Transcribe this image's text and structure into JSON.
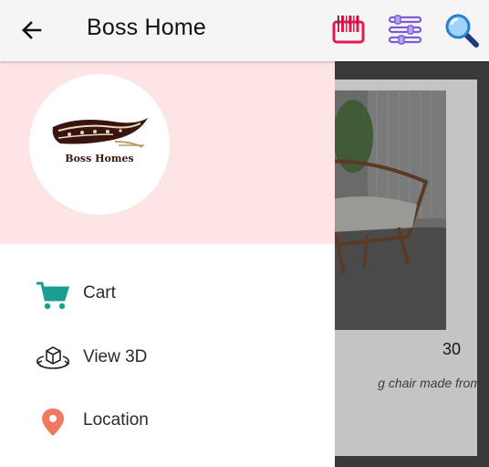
{
  "app_bar": {
    "title": "Boss Home",
    "icons": [
      "back-arrow-icon",
      "barcode-icon",
      "filter-sliders-icon",
      "search-icon"
    ],
    "colors": {
      "barcode": "#e5194f",
      "filter": "#7b5cd6",
      "search": "#2a7fd4"
    }
  },
  "drawer": {
    "logo_text": "Boss Homes",
    "header_color": "#fde5e5",
    "items": [
      {
        "label": "Cart",
        "icon": "cart-icon",
        "color": "#1a9e8f"
      },
      {
        "label": "View 3D",
        "icon": "view-3d-icon",
        "color": "#222222"
      },
      {
        "label": "Location",
        "icon": "location-pin-icon",
        "color": "#ef7a5f"
      }
    ]
  },
  "background_product": {
    "price": "30",
    "description": "g chair made from"
  }
}
